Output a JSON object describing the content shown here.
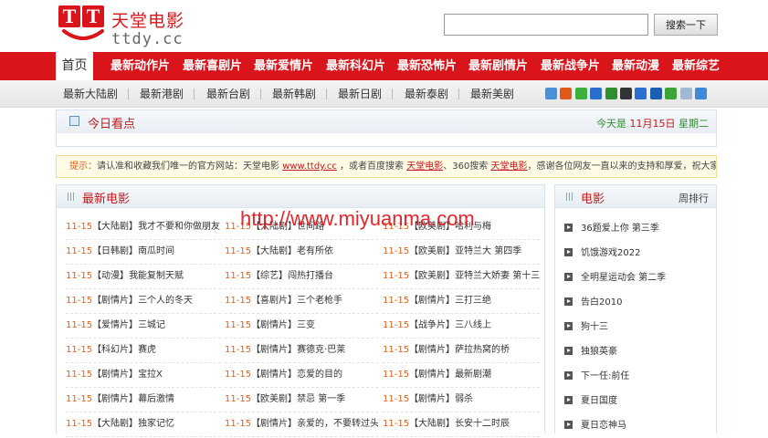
{
  "logo": {
    "mark": [
      "T",
      "T"
    ],
    "name_cn": "天堂电影",
    "name_en": "ttdy.cc"
  },
  "search": {
    "value": "",
    "placeholder": "",
    "button_label": "搜索一下"
  },
  "nav": {
    "home": "首页",
    "items": [
      "最新动作片",
      "最新喜剧片",
      "最新爱情片",
      "最新科幻片",
      "最新恐怖片",
      "最新剧情片",
      "最新战争片",
      "最新动漫",
      "最新综艺"
    ]
  },
  "subnav": {
    "items": [
      "最新大陆剧",
      "最新港剧",
      "最新台剧",
      "最新韩剧",
      "最新日剧",
      "最新泰剧",
      "最新美剧"
    ],
    "share_icons": [
      "qzone-icon",
      "sina-weibo-icon",
      "wechat-icon",
      "baidu-icon",
      "douban-icon",
      "qq-icon",
      "tencent-icon",
      "renren-icon",
      "kaixin-icon",
      "bookmark-icon",
      "more-share-icon"
    ],
    "share_colors": [
      "#4a90d9",
      "#e05a1a",
      "#3bb03b",
      "#2a6fd0",
      "#2f8f2f",
      "#333333",
      "#2a6fd0",
      "#1b5fb5",
      "#3aa63a",
      "#9fb9d6",
      "#3c8ad8"
    ]
  },
  "today": {
    "title": "今日看点",
    "date_prefix": "今天是",
    "date_value": "11月15日",
    "weekday": "星期二"
  },
  "notice": {
    "tip": "提示：",
    "text1": "请认准和收藏我们唯一的官方网站：天堂电影",
    "link1": "www.ttdy.cc",
    "text2": "，或者百度搜索",
    "link2": "天堂电影",
    "text3": "、360搜索",
    "link3": "天堂电影",
    "text4": "，感谢各位网友一直以来的支持和厚爱，祝大家顺心如意！"
  },
  "latest": {
    "title": "最新电影",
    "movies": [
      [
        "11-15",
        "【大陆剧】",
        "我才不要和你做朋友"
      ],
      [
        "11-15",
        "【大陆剧】",
        "世间路"
      ],
      [
        "11-15",
        "【欧美剧】",
        "哈利与梅"
      ],
      [
        "11-15",
        "【日韩剧】",
        "南瓜时间"
      ],
      [
        "11-15",
        "【大陆剧】",
        "老有所依"
      ],
      [
        "11-15",
        "【欧美剧】",
        "亚特兰大 第四季"
      ],
      [
        "11-15",
        "【动漫】",
        "我能复制天赋"
      ],
      [
        "11-15",
        "【综艺】",
        "闯热打播台"
      ],
      [
        "11-15",
        "【欧美剧】",
        "亚特兰大娇妻 第十三季"
      ],
      [
        "11-15",
        "【剧情片】",
        "三个人的冬天"
      ],
      [
        "11-15",
        "【喜剧片】",
        "三个老枪手"
      ],
      [
        "11-15",
        "【剧情片】",
        "三打三绝"
      ],
      [
        "11-15",
        "【爱情片】",
        "三城记"
      ],
      [
        "11-15",
        "【剧情片】",
        "三变"
      ],
      [
        "11-15",
        "【战争片】",
        "三八线上"
      ],
      [
        "11-15",
        "【科幻片】",
        "赛虎"
      ],
      [
        "11-15",
        "【剧情片】",
        "赛德克·巴莱"
      ],
      [
        "11-15",
        "【剧情片】",
        "萨拉热窝的桥"
      ],
      [
        "11-15",
        "【剧情片】",
        "宝拉X"
      ],
      [
        "11-15",
        "【剧情片】",
        "恋爱的目的"
      ],
      [
        "11-15",
        "【剧情片】",
        "最新剧潮"
      ],
      [
        "11-15",
        "【剧情片】",
        "幕后激情"
      ],
      [
        "11-15",
        "【欧美剧】",
        "禁忌 第一季"
      ],
      [
        "11-15",
        "【剧情片】",
        "弱杀"
      ],
      [
        "11-15",
        "【大陆剧】",
        "独家记忆"
      ],
      [
        "11-15",
        "【剧情片】",
        "亲爱的，不要转过头"
      ],
      [
        "11-15",
        "【大陆剧】",
        "长安十二时辰"
      ]
    ]
  },
  "side": {
    "title": "电影",
    "sort_label": "周排行",
    "items": [
      "36题爱上你 第三季",
      "饥饿游戏2022",
      "全明星运动会 第二季",
      "告白2010",
      "狗十三",
      "独狼英豪",
      "下一任:前任",
      "夏日国度",
      "夏日恋神马"
    ]
  },
  "watermark": "http://www.miyuanma.com"
}
